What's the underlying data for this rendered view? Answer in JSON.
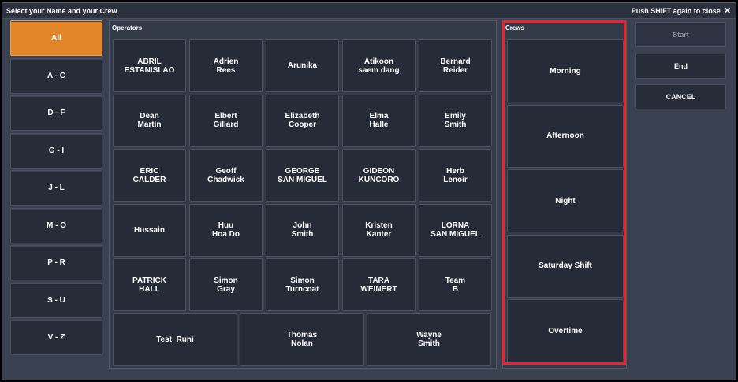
{
  "window": {
    "title": "Select your Name and your Crew",
    "close_label": "Push SHIFT again to close",
    "close_icon": "✕"
  },
  "letters": {
    "items": [
      "All",
      "A - C",
      "D - F",
      "G - I",
      "J - L",
      "M - O",
      "P - R",
      "S - U",
      "V - Z"
    ],
    "selected": "All",
    "accent_color": "#e3862a"
  },
  "operators": {
    "title": "Operators",
    "items": [
      "ABRIL\nESTANISLAO",
      "Adrien\nRees",
      "Arunika",
      "Atikoon\nsaem dang",
      "Bernard\nReider",
      "Dean\nMartin",
      "Elbert\nGillard",
      "Elizabeth\nCooper",
      "Elma\nHalle",
      "Emily\nSmith",
      "ERIC\nCALDER",
      "Geoff\nChadwick",
      "GEORGE\nSAN MIGUEL",
      "GIDEON\nKUNCORO",
      "Herb\nLenoir",
      "Hussain",
      "Huu\nHoa Do",
      "John\nSmith",
      "Kristen\nKanter",
      "LORNA\nSAN MIGUEL",
      "PATRICK\nHALL",
      "Simon\nGray",
      "Simon\nTurncoat",
      "TARA\nWEINERT",
      "Team\nB",
      "Test_Runi",
      "Thomas\nNolan",
      "Wayne\nSmith"
    ]
  },
  "crews": {
    "title": "Crews",
    "items": [
      "Morning",
      "Afternoon",
      "Night",
      "Saturday Shift",
      "Overtime"
    ],
    "highlight_color": "#e8242c"
  },
  "actions": {
    "start_label": "Start",
    "end_label": "End",
    "cancel_label": "CANCEL"
  }
}
